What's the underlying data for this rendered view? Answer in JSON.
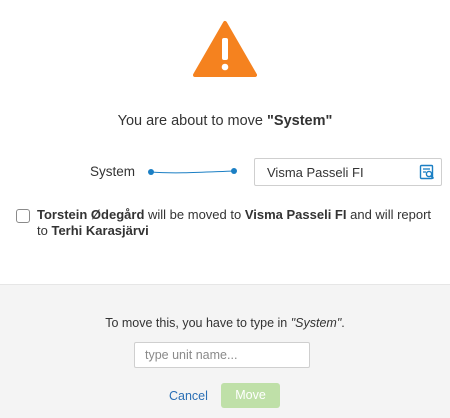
{
  "dialog": {
    "title_prefix": "You are about to move ",
    "title_name": "\"System\"",
    "source_label": "System",
    "target_value": "Visma Passeli FI",
    "check": {
      "person": "Torstein Ødegård",
      "mid": " will be moved to ",
      "target": "Visma Passeli FI",
      "mid2": " and will report to ",
      "manager": "Terhi Karasjärvi"
    }
  },
  "confirm": {
    "instruction_prefix": "To move this, you have to type in ",
    "instruction_name": "\"System\"",
    "instruction_suffix": ".",
    "input_placeholder": "type unit name...",
    "input_value": "",
    "cancel_label": "Cancel",
    "move_label": "Move"
  },
  "colors": {
    "warning": "#f5821f",
    "link": "#2a6fb5",
    "move_button_disabled": "#bfe0a8",
    "connector": "#1b7fc4"
  },
  "icons": {
    "warning": "warning-triangle-icon",
    "lookup": "search-list-icon"
  }
}
